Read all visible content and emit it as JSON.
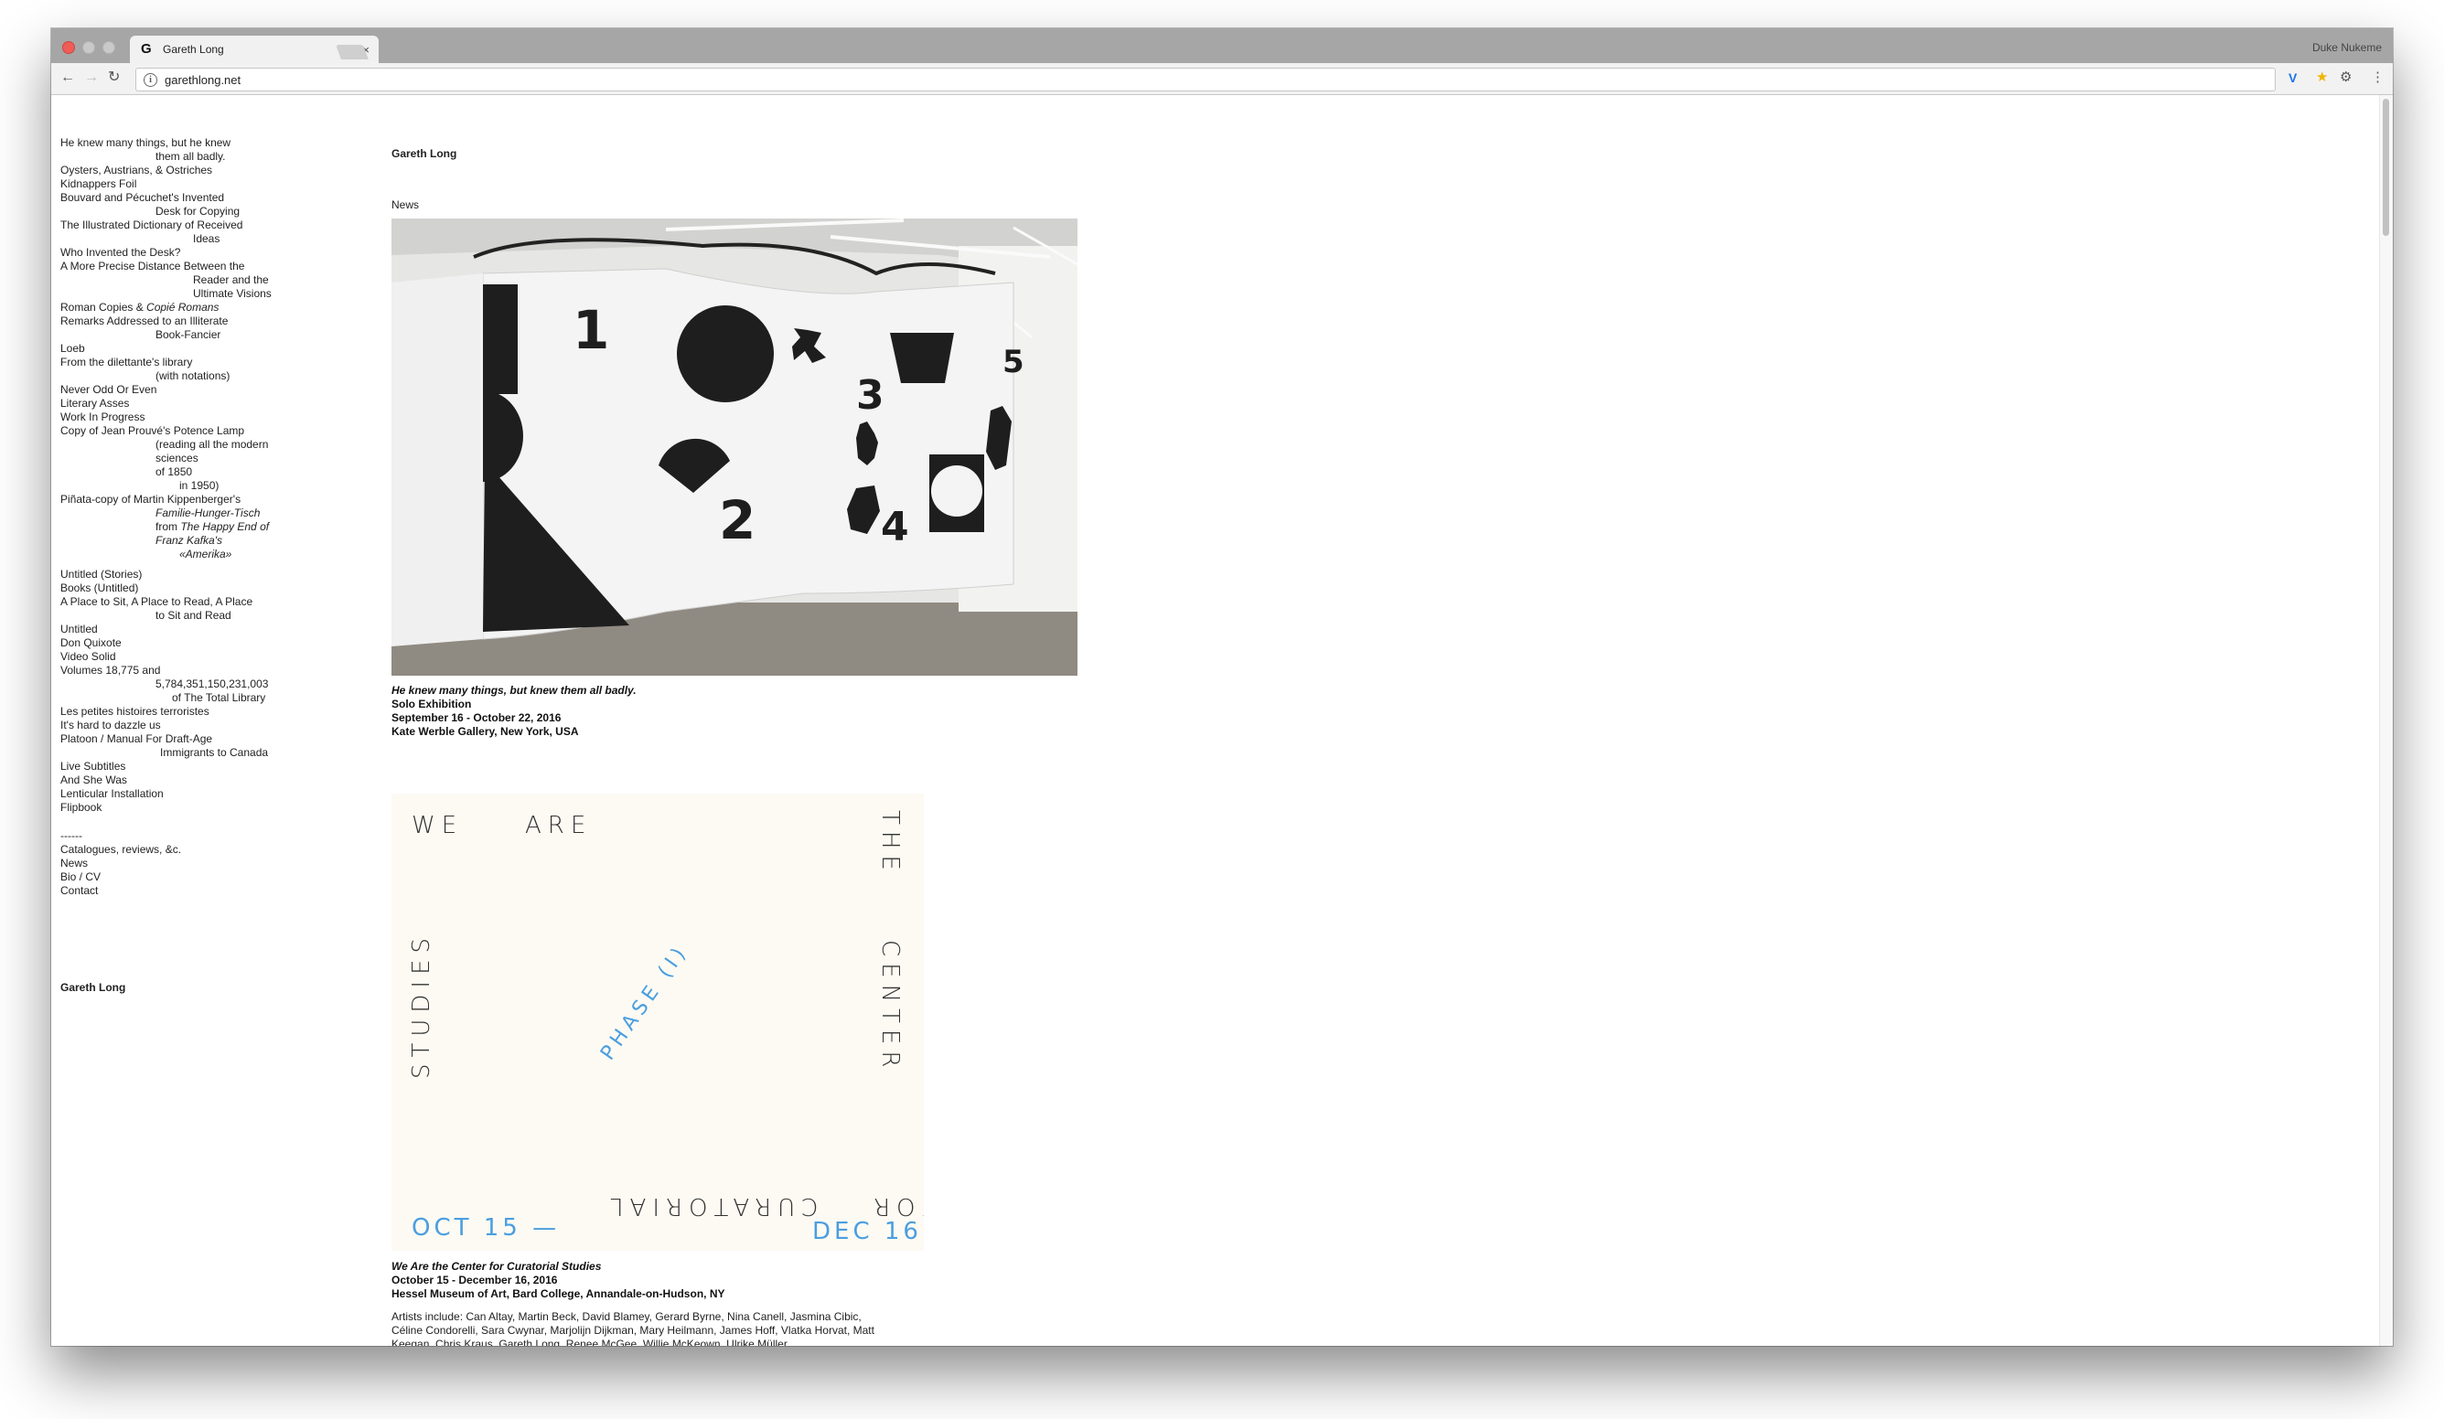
{
  "browser": {
    "tab_title": "Gareth Long",
    "favicon_letter": "G",
    "tab_close": "×",
    "profile_name": "Duke Nukeme",
    "url": "garethlong.net"
  },
  "sidebar": {
    "entries": [
      {
        "lines": [
          "He knew many things, but he knew",
          "them all badly."
        ]
      },
      {
        "lines": [
          "Oysters, Austrians, & Ostriches"
        ]
      },
      {
        "lines": [
          "Kidnappers Foil"
        ]
      },
      {
        "lines": [
          "Bouvard and Pécuchet's Invented",
          "Desk for Copying"
        ]
      },
      {
        "lines": [
          "The Illustrated Dictionary of Received",
          "Ideas"
        ]
      },
      {
        "lines": [
          "Who Invented the Desk?"
        ]
      },
      {
        "lines": [
          "A More Precise Distance Between the",
          "Reader and the",
          "Ultimate Visions"
        ]
      },
      {
        "lines": [
          "Roman Copies & ",
          "Copié Romans"
        ]
      },
      {
        "lines": [
          "Remarks Addressed to an Illiterate",
          "Book-Fancier"
        ]
      },
      {
        "lines": [
          "Loeb"
        ]
      },
      {
        "lines": [
          "From the dilettante's library",
          "(with notations)"
        ]
      },
      {
        "lines": [
          "Never Odd Or Even"
        ]
      },
      {
        "lines": [
          "Literary Asses"
        ]
      },
      {
        "lines": [
          "Work In Progress"
        ]
      },
      {
        "lines": [
          "Copy of Jean Prouvé's Potence Lamp",
          "(reading all the modern",
          "sciences",
          "of 1850",
          "in 1950)"
        ]
      },
      {
        "lines": [
          "Piñata-copy of Martin Kippenberger's",
          "Familie-Hunger-Tisch",
          "from ",
          "The Happy End of",
          "Franz Kafka's",
          "«Amerika»"
        ]
      },
      {
        "lines": [
          "Untitled (Stories)"
        ]
      },
      {
        "lines": [
          "Books (Untitled)"
        ]
      },
      {
        "lines": [
          "A Place to Sit, A Place to Read, A Place",
          "to Sit and Read"
        ]
      },
      {
        "lines": [
          "Untitled"
        ]
      },
      {
        "lines": [
          "Don Quixote"
        ]
      },
      {
        "lines": [
          "Video Solid"
        ]
      },
      {
        "lines": [
          "Volumes 18,775 and",
          "5,784,351,150,231,003",
          "of The Total Library"
        ]
      },
      {
        "lines": [
          "Les petites histoires terroristes"
        ]
      },
      {
        "lines": [
          "It's hard to dazzle us"
        ]
      },
      {
        "lines": [
          "Platoon / Manual For Draft-Age",
          "Immigrants to Canada"
        ]
      },
      {
        "lines": [
          "Live Subtitles"
        ]
      },
      {
        "lines": [
          "And She Was"
        ]
      },
      {
        "lines": [
          "Lenticular Installation"
        ]
      },
      {
        "lines": [
          "Flipbook"
        ]
      }
    ],
    "separator": "------",
    "secondary": [
      "Catalogues, reviews, &c.",
      "News",
      "Bio / CV",
      "Contact"
    ],
    "footer_name": "Gareth Long"
  },
  "main": {
    "site_title": "Gareth Long",
    "section": "News",
    "items": [
      {
        "title": "He knew many things, but knew them all badly.",
        "type": "Solo Exhibition",
        "dates": "September 16 - October 22, 2016",
        "venue": "Kate Werble Gallery, New York, USA",
        "numbers": [
          "1",
          "3",
          "2",
          "4",
          "5"
        ]
      },
      {
        "poster": {
          "we": "WE",
          "are": "ARE",
          "the": "THE",
          "center": "CENTER",
          "studies": "STUDIES",
          "phase": "PHASE (I)",
          "curatorial": "CURATORIAL",
          "for": "FOR",
          "start": "OCT 15 —",
          "end": "DEC 16"
        },
        "title": "We Are the Center for Curatorial Studies",
        "dates": "October 15 - December 16, 2016",
        "venue": "Hessel Museum of Art, Bard College, Annandale-on-Hudson, NY",
        "artists": "Artists include: Can Altay, Martin Beck, David Blamey, Gerard Byrne, Nina Canell, Jasmina Cibic, Céline Condorelli, Sara Cwynar, Marjolijn Dijkman, Mary Heilmann, James Hoff, Vlatka Horvat, Matt Keegan, Chris Kraus, Gareth Long, Renee McGee, Willie McKeown, Ulrike Müller"
      }
    ]
  },
  "colors": {
    "titlebar": "#a6a6a6",
    "toolbar": "#f2f2f2",
    "poster_blue": "#4a9ee0",
    "poster_bg": "#fcfaf3"
  },
  "icons": [
    "back-icon",
    "forward-icon",
    "reload-icon",
    "info-icon",
    "extension-icon",
    "star-icon",
    "sync-icon",
    "menu-icon",
    "close-icon"
  ]
}
